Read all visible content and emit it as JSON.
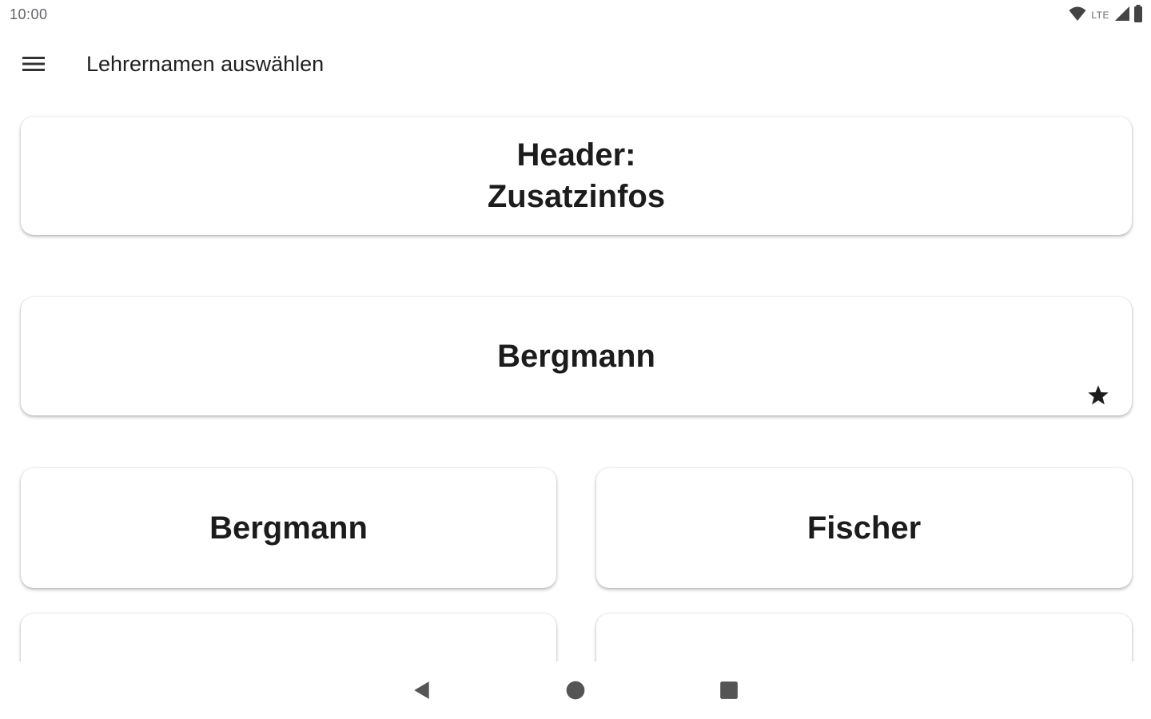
{
  "status_bar": {
    "time": "10:00",
    "network": "LTE",
    "icons": [
      "wifi-icon",
      "cell-signal-icon",
      "battery-icon"
    ]
  },
  "app_bar": {
    "menu_icon": "hamburger-menu-icon",
    "title": "Lehrernamen auswählen"
  },
  "list": {
    "header_card": {
      "line1": "Header:",
      "line2": "Zusatzinfos"
    },
    "favorite_card": {
      "label": "Bergmann",
      "icon": "star-icon"
    },
    "grid": [
      {
        "label": "Bergmann"
      },
      {
        "label": "Fischer"
      },
      {
        "label": ""
      },
      {
        "label": ""
      }
    ]
  },
  "nav_bar": {
    "icons": [
      "back-icon",
      "home-icon",
      "recents-icon"
    ]
  },
  "colors": {
    "background": "#ffffff",
    "text": "#1c1c1c",
    "status_text": "#5f6368"
  }
}
